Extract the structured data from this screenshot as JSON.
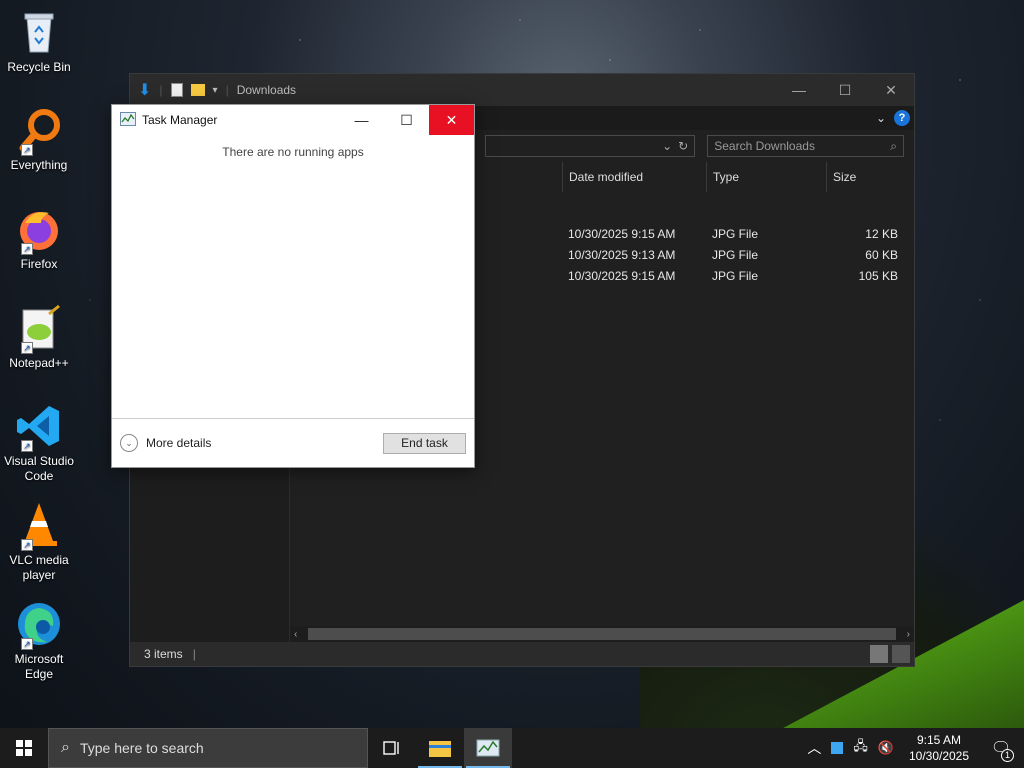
{
  "desktop": {
    "icons": [
      {
        "label": "Recycle Bin",
        "icon": "recycle-bin-icon"
      },
      {
        "label": "Everything",
        "icon": "everything-search-icon"
      },
      {
        "label": "Firefox",
        "icon": "firefox-icon"
      },
      {
        "label": "Notepad++",
        "icon": "notepad-plus-plus-icon"
      },
      {
        "label": "Visual Studio Code",
        "icon": "vscode-icon"
      },
      {
        "label": "VLC media player",
        "icon": "vlc-icon"
      },
      {
        "label": "Microsoft Edge",
        "icon": "edge-icon"
      }
    ]
  },
  "explorer": {
    "title": "Downloads",
    "search_placeholder": "Search Downloads",
    "columns": {
      "date": "Date modified",
      "type": "Type",
      "size": "Size"
    },
    "files": [
      {
        "date": "10/30/2025 9:15 AM",
        "type": "JPG File",
        "size": "12 KB"
      },
      {
        "date": "10/30/2025 9:13 AM",
        "type": "JPG File",
        "size": "60 KB"
      },
      {
        "date": "10/30/2025 9:15 AM",
        "type": "JPG File",
        "size": "105 KB"
      }
    ],
    "status": "3 items"
  },
  "taskmanager": {
    "title": "Task Manager",
    "empty_message": "There are no running apps",
    "more_details": "More details",
    "end_task": "End task"
  },
  "taskbar": {
    "search_placeholder": "Type here to search",
    "time": "9:15 AM",
    "date": "10/30/2025",
    "notification_count": "1"
  },
  "colors": {
    "accent": "#0078d7",
    "close_red": "#e81123",
    "explorer_bg": "#202020",
    "taskbar_bg": "#1c1c1c"
  }
}
